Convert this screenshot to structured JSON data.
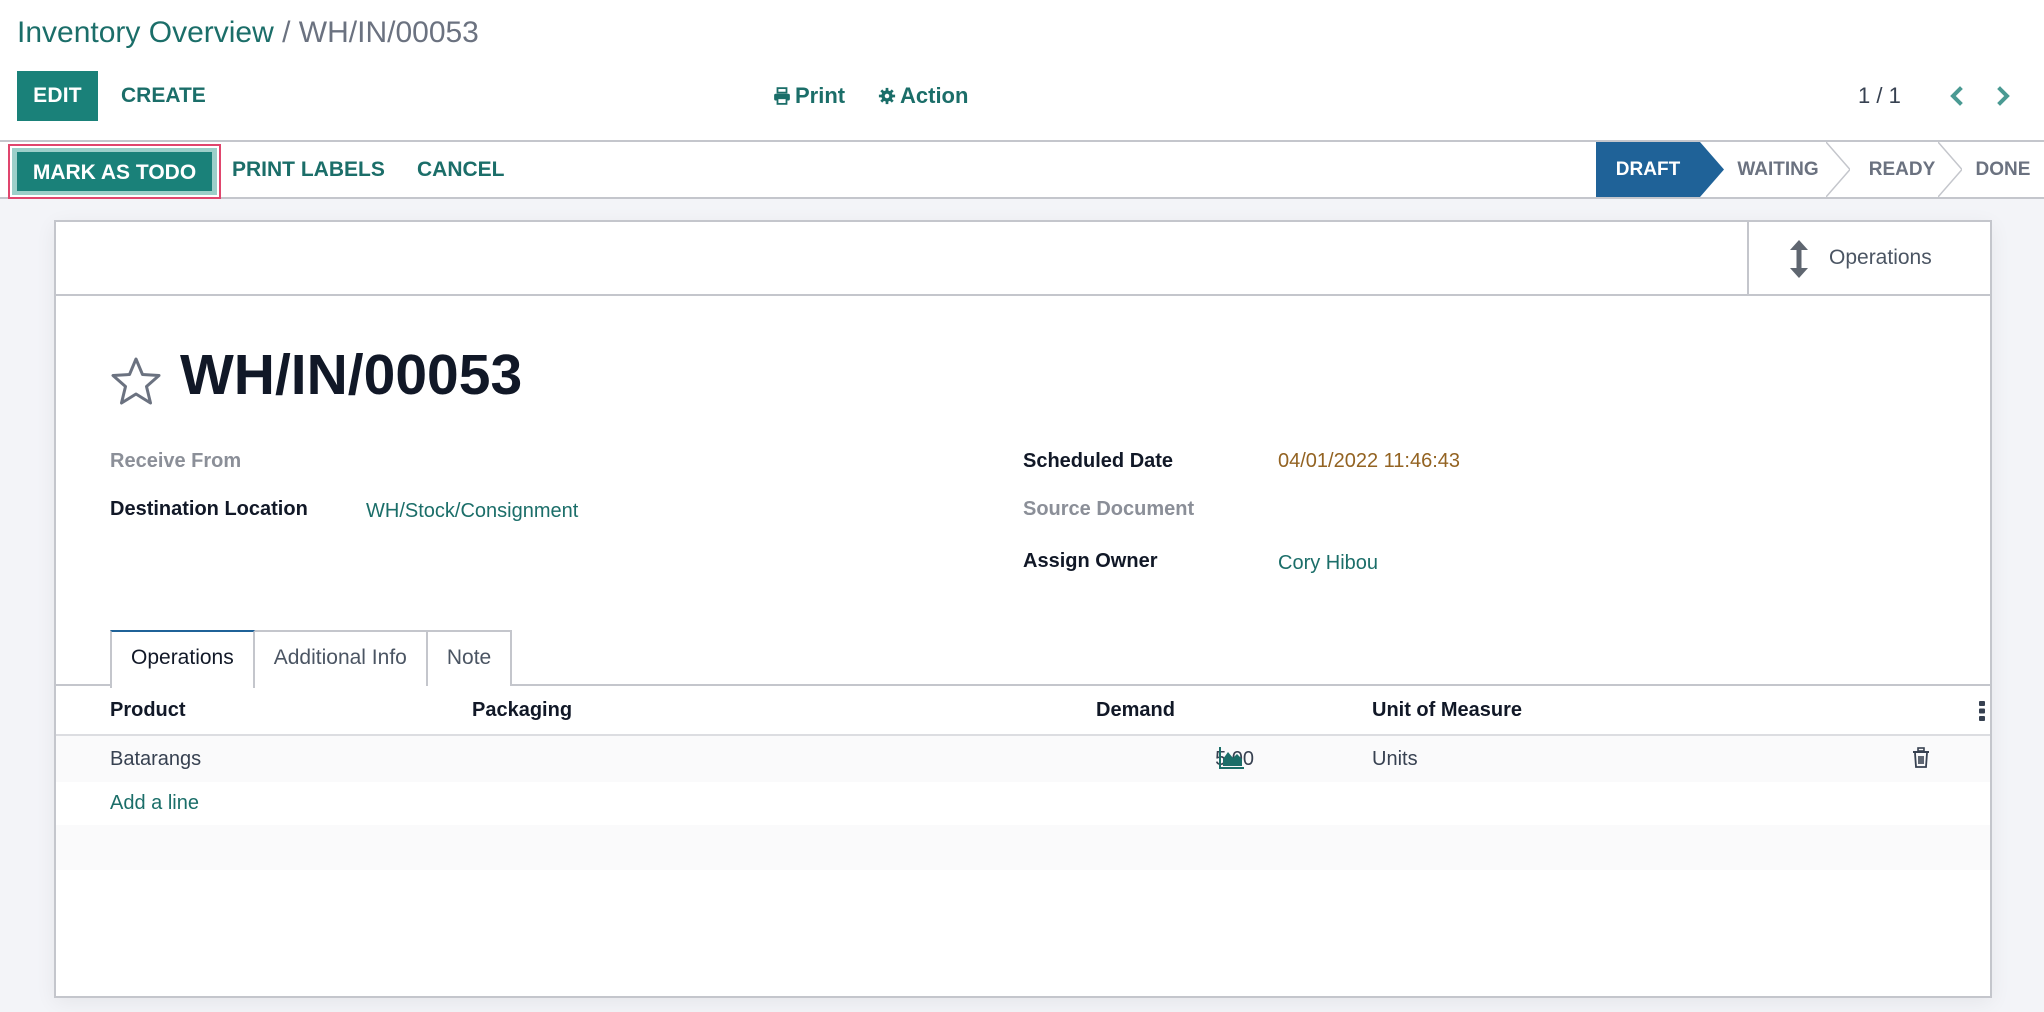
{
  "breadcrumb": {
    "parent": "Inventory Overview",
    "separator": "/",
    "current": "WH/IN/00053"
  },
  "toolbar": {
    "edit_label": "EDIT",
    "create_label": "CREATE",
    "print_label": "Print",
    "action_label": "Action",
    "print_icon": "printer-icon",
    "action_icon": "gear-icon"
  },
  "pager": {
    "value": "1 / 1",
    "prev_icon": "chevron-left-icon",
    "next_icon": "chevron-right-icon"
  },
  "statusbar": {
    "buttons": {
      "mark_as_todo": "MARK AS TODO",
      "print_labels": "PRINT LABELS",
      "cancel": "CANCEL"
    },
    "stages": [
      {
        "label": "DRAFT",
        "active": true
      },
      {
        "label": "WAITING",
        "active": false
      },
      {
        "label": "READY",
        "active": false
      },
      {
        "label": "DONE",
        "active": false
      }
    ]
  },
  "smart_button": {
    "label": "Operations",
    "icon": "arrows-vertical-icon"
  },
  "record": {
    "title": "WH/IN/00053",
    "favorite": false,
    "fields_left": [
      {
        "label": "Receive From",
        "value": "",
        "required": false
      },
      {
        "label": "Destination Location",
        "value": "WH/Stock/Consignment",
        "required": true
      }
    ],
    "fields_right": [
      {
        "label": "Scheduled Date",
        "value": "04/01/2022 11:46:43",
        "required": true
      },
      {
        "label": "Source Document",
        "value": "",
        "required": false
      },
      {
        "label": "Assign Owner",
        "value": "Cory Hibou",
        "required": true
      }
    ]
  },
  "tabs": [
    {
      "label": "Operations",
      "active": true
    },
    {
      "label": "Additional Info",
      "active": false
    },
    {
      "label": "Note",
      "active": false
    }
  ],
  "operations_table": {
    "columns": [
      "Product",
      "Packaging",
      "Demand",
      "Unit of Measure"
    ],
    "rows": [
      {
        "product": "Batarangs",
        "packaging": "",
        "demand": "5.00",
        "uom": "Units"
      }
    ],
    "add_line_label": "Add a line"
  },
  "colors": {
    "brand": "#1a8179",
    "link": "#1b6e69",
    "active_stage": "#1f6298",
    "highlight_border": "#e0456d",
    "date_warning": "#936322"
  }
}
